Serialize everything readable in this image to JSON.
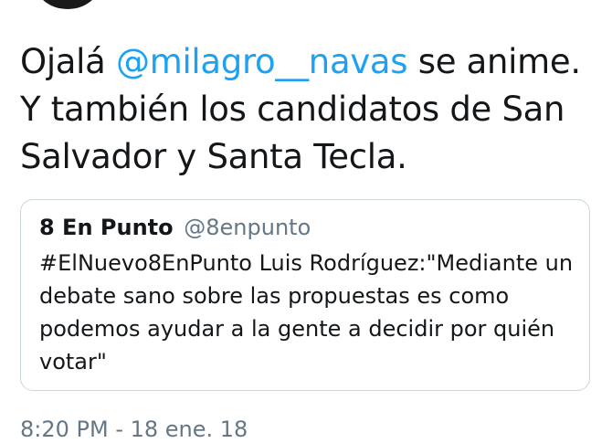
{
  "tweet": {
    "text_before": "Ojalá ",
    "mention": "@milagro__navas",
    "text_after": " se anime. Y también los candidatos de San Salvador y Santa Tecla."
  },
  "quote": {
    "name": "8 En Punto",
    "handle": "@8enpunto",
    "text": "#ElNuevo8EnPunto Luis Rodríguez:\"Mediante un debate sano sobre las propuestas es como podemos ayudar a la gente a decidir por quién votar\""
  },
  "timestamp": "8:20 PM - 18 ene. 18",
  "colors": {
    "link": "#1da1f2",
    "text": "#14171a",
    "secondary": "#657786",
    "border": "#ccd6dd"
  }
}
